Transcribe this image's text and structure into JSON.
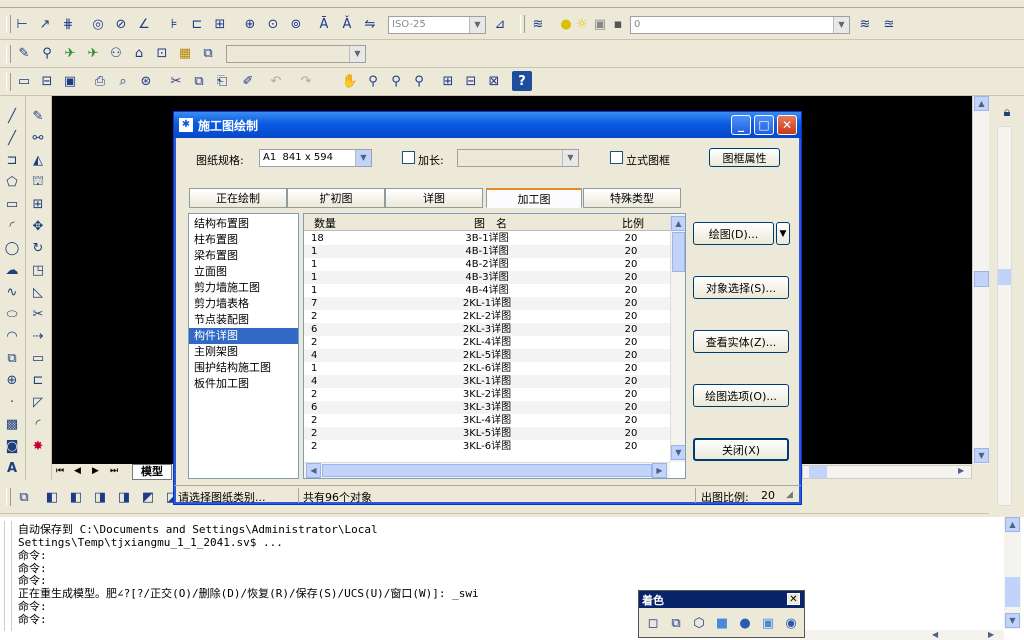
{
  "toolbar_combos": {
    "text_style": "ISO-25",
    "layer": "0"
  },
  "model_tab": "模型",
  "dialog": {
    "title": "施工图绘制",
    "paper_label": "图纸规格:",
    "paper_value": "A1  841 x 594",
    "extend_label": "加长:",
    "vertical_label": "立式图框",
    "frame_props_button": "图框属性",
    "tabs": [
      {
        "label": "正在绘制",
        "active": false
      },
      {
        "label": "扩初图",
        "active": false
      },
      {
        "label": "详图",
        "active": false
      },
      {
        "label": "加工图",
        "active": true
      },
      {
        "label": "特殊类型",
        "active": false
      }
    ],
    "categories": [
      {
        "label": "结构布置图",
        "selected": false
      },
      {
        "label": "柱布置图",
        "selected": false
      },
      {
        "label": "梁布置图",
        "selected": false
      },
      {
        "label": "立面图",
        "selected": false
      },
      {
        "label": "剪力墙施工图",
        "selected": false
      },
      {
        "label": "剪力墙表格",
        "selected": false
      },
      {
        "label": "节点装配图",
        "selected": false
      },
      {
        "label": "构件详图",
        "selected": true
      },
      {
        "label": "主刚架图",
        "selected": false
      },
      {
        "label": "围护结构施工图",
        "selected": false
      },
      {
        "label": "板件加工图",
        "selected": false
      }
    ],
    "columns": [
      "数量",
      "图　名",
      "比例"
    ],
    "rows": [
      {
        "qty": "18",
        "name": "3B-1详图",
        "scale": "20"
      },
      {
        "qty": "1",
        "name": "4B-1详图",
        "scale": "20"
      },
      {
        "qty": "1",
        "name": "4B-2详图",
        "scale": "20"
      },
      {
        "qty": "1",
        "name": "4B-3详图",
        "scale": "20"
      },
      {
        "qty": "1",
        "name": "4B-4详图",
        "scale": "20"
      },
      {
        "qty": "7",
        "name": "2KL-1详图",
        "scale": "20"
      },
      {
        "qty": "2",
        "name": "2KL-2详图",
        "scale": "20"
      },
      {
        "qty": "6",
        "name": "2KL-3详图",
        "scale": "20"
      },
      {
        "qty": "2",
        "name": "2KL-4详图",
        "scale": "20"
      },
      {
        "qty": "4",
        "name": "2KL-5详图",
        "scale": "20"
      },
      {
        "qty": "1",
        "name": "2KL-6详图",
        "scale": "20"
      },
      {
        "qty": "4",
        "name": "3KL-1详图",
        "scale": "20"
      },
      {
        "qty": "2",
        "name": "3KL-2详图",
        "scale": "20"
      },
      {
        "qty": "6",
        "name": "3KL-3详图",
        "scale": "20"
      },
      {
        "qty": "2",
        "name": "3KL-4详图",
        "scale": "20"
      },
      {
        "qty": "2",
        "name": "3KL-5详图",
        "scale": "20"
      },
      {
        "qty": "2",
        "name": "3KL-6详图",
        "scale": "20"
      }
    ],
    "buttons": {
      "draw": "绘图(D)...",
      "object_select": "对象选择(S)...",
      "view_entity": "查看实体(Z)...",
      "draw_options": "绘图选项(O)...",
      "close": "关闭(X)"
    },
    "status_hint": "请选择图纸类别...",
    "status_count": "共有96个对象",
    "status_scale_label": "出图比例:",
    "status_scale_value": "20"
  },
  "command_lines": [
    "自动保存到 C:\\Documents and Settings\\Administrator\\Local",
    "Settings\\Temp\\tjxiangmu_1_1_2041.sv$ ...",
    "命令:",
    "命令:",
    "命令:",
    "正在重生成模型。肥∠?[?/正交(O)/删除(D)/恢复(R)/保存(S)/UCS(U)/窗口(W)]: _swi",
    "命令:",
    "命令:"
  ],
  "shade_toolbar_title": "着色"
}
